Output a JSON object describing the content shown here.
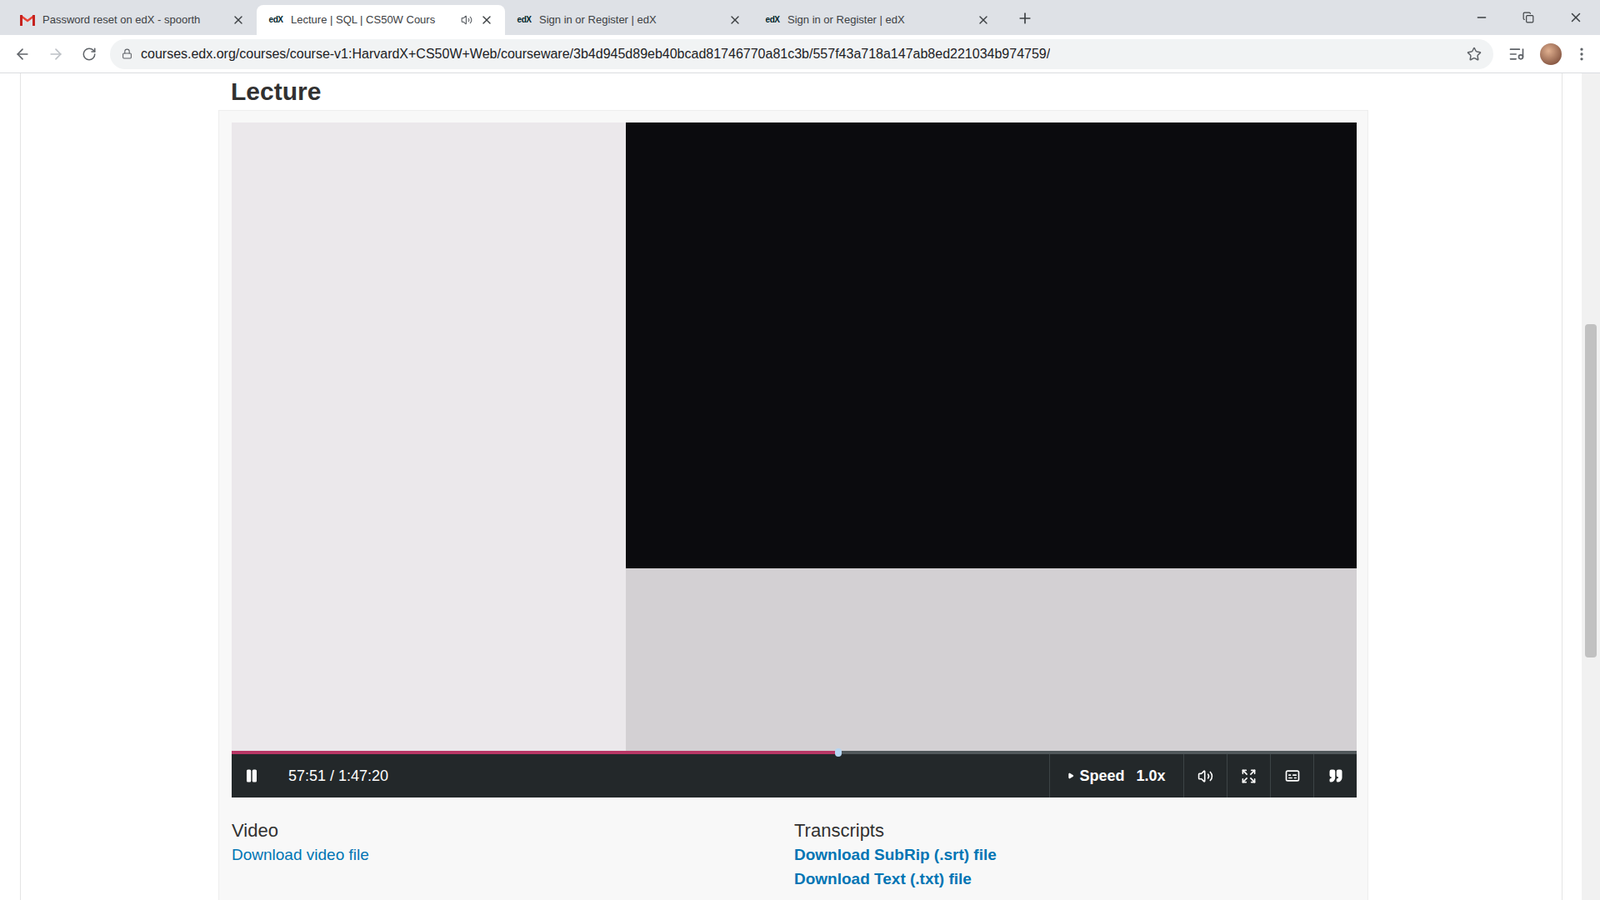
{
  "browser": {
    "tabs": [
      {
        "title": "Password reset on edX - spoorth",
        "kind": "gmail",
        "selected": false,
        "audio": false
      },
      {
        "title": "Lecture | SQL | CS50W Cours",
        "kind": "edx",
        "selected": true,
        "audio": true
      },
      {
        "title": "Sign in or Register | edX",
        "kind": "edx",
        "selected": false,
        "audio": false
      },
      {
        "title": "Sign in or Register | edX",
        "kind": "edx",
        "selected": false,
        "audio": false
      }
    ],
    "favicon_text": "edX",
    "url": "courses.edx.org/courses/course-v1:HarvardX+CS50W+Web/courseware/3b4d945d89eb40bcad81746770a81c3b/557f43a718a147ab8ed221034b974759/",
    "bookmarked": false
  },
  "page": {
    "heading": "Lecture",
    "video": {
      "playing": true,
      "time": "57:51 / 1:47:20",
      "level": 0.539,
      "speed_label": "Speed",
      "speed": "1.0x"
    },
    "downloads": [
      {
        "heading": "Video",
        "links": [
          "Download video file"
        ]
      },
      {
        "heading": "Transcripts",
        "links": [
          "Download SubRip (.srt) file",
          "Download Text (.txt) file"
        ]
      }
    ]
  }
}
